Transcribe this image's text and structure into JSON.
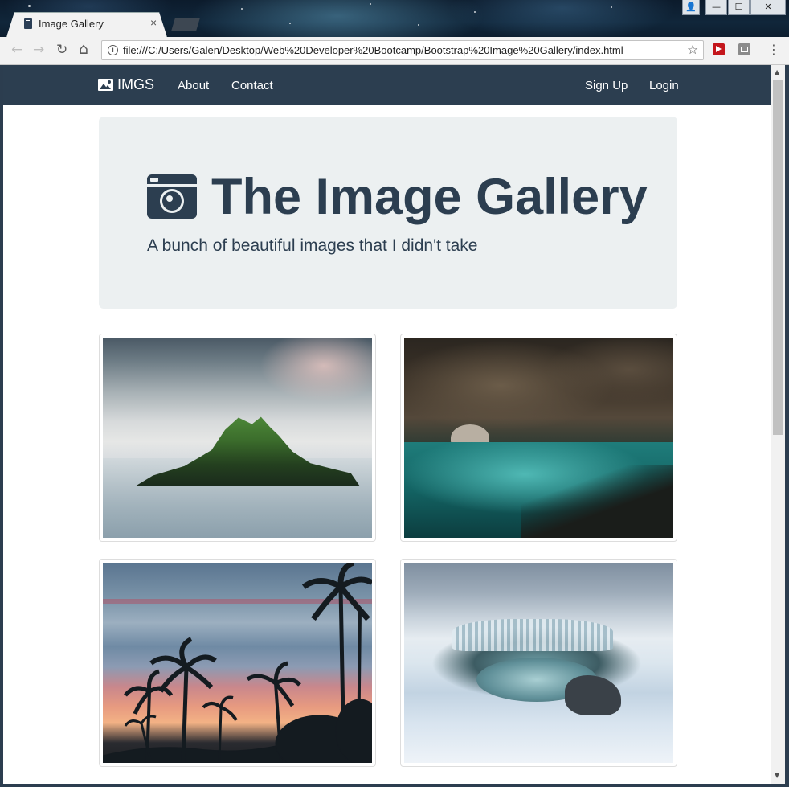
{
  "browser": {
    "tab_title": "Image Gallery",
    "tab_close": "×",
    "url": "file:///C:/Users/Galen/Desktop/Web%20Developer%20Bootcamp/Bootstrap%20Image%20Gallery/index.html",
    "back_icon": "←",
    "forward_icon": "→",
    "reload_icon": "↻",
    "home_icon": "⌂",
    "bookmark_icon": "☆",
    "menu_icon": "⋮",
    "info_icon": "i",
    "window_controls": {
      "user": "👤",
      "minimize": "—",
      "maximize": "☐",
      "close": "✕"
    }
  },
  "navbar": {
    "brand": "IMGS",
    "links_left": [
      "About",
      "Contact"
    ],
    "links_right": [
      "Sign Up",
      "Login"
    ]
  },
  "jumbotron": {
    "title": "The Image Gallery",
    "subtitle": "A bunch of beautiful images that I didn't take"
  },
  "gallery": {
    "images": [
      "island-photo",
      "cave-lagoon-photo",
      "palm-sunset-photo",
      "icy-waterfall-photo"
    ]
  },
  "colors": {
    "navbar_bg": "#2c3e50",
    "jumbotron_bg": "#ecf0f1",
    "heading_text": "#2c3e50"
  },
  "scrollbar": {
    "up": "▲",
    "down": "▼"
  }
}
